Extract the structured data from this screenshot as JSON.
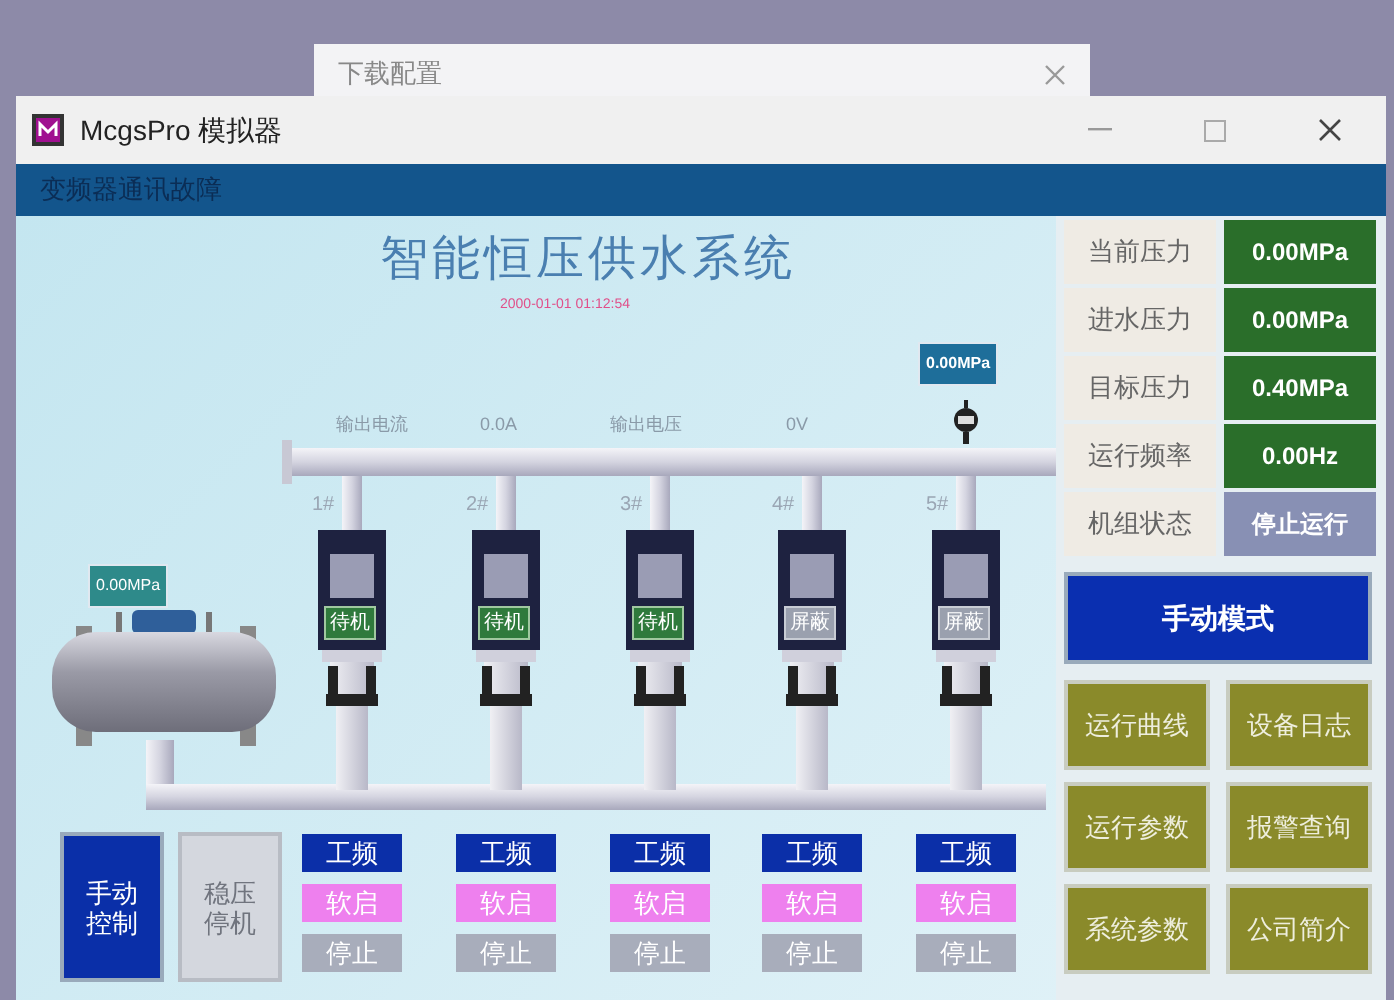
{
  "background_window": {
    "title": "下载配置"
  },
  "window": {
    "title": "McgsPro 模拟器"
  },
  "status_bar": {
    "text": "变频器通讯故障"
  },
  "main": {
    "title": "智能恒压供水系统",
    "timestamp": "2000-01-01 01:12:54",
    "readings": [
      {
        "label": "输出电流",
        "value": "0.0A"
      },
      {
        "label": "输出电压",
        "value": "0V"
      }
    ],
    "outlet_pressure": "0.00MPa",
    "tank_pressure": "0.00MPa",
    "pumps": [
      {
        "number": "1#",
        "status": "待机",
        "kind": "standby",
        "buttons": [
          {
            "label": "工频",
            "kind": "mains"
          },
          {
            "label": "软启",
            "kind": "soft_start"
          },
          {
            "label": "停止",
            "kind": "stop"
          }
        ]
      },
      {
        "number": "2#",
        "status": "待机",
        "kind": "standby",
        "buttons": [
          {
            "label": "工频",
            "kind": "mains"
          },
          {
            "label": "软启",
            "kind": "soft_start"
          },
          {
            "label": "停止",
            "kind": "stop"
          }
        ]
      },
      {
        "number": "3#",
        "status": "待机",
        "kind": "standby",
        "buttons": [
          {
            "label": "工频",
            "kind": "mains"
          },
          {
            "label": "软启",
            "kind": "soft_start"
          },
          {
            "label": "停止",
            "kind": "stop"
          }
        ]
      },
      {
        "number": "4#",
        "status": "屏蔽",
        "kind": "blocked",
        "buttons": [
          {
            "label": "工频",
            "kind": "mains"
          },
          {
            "label": "软启",
            "kind": "soft_start"
          },
          {
            "label": "停止",
            "kind": "stop"
          }
        ]
      },
      {
        "number": "5#",
        "status": "屏蔽",
        "kind": "blocked",
        "buttons": [
          {
            "label": "工频",
            "kind": "mains"
          },
          {
            "label": "软启",
            "kind": "soft_start"
          },
          {
            "label": "停止",
            "kind": "stop"
          }
        ]
      }
    ],
    "control_buttons": [
      {
        "label": "手动控制",
        "disabled": false
      },
      {
        "label": "稳压停机",
        "disabled": true
      }
    ]
  },
  "side_panel": {
    "rows": [
      {
        "label": "当前压力",
        "value": "0.00MPa",
        "kind": "value"
      },
      {
        "label": "进水压力",
        "value": "0.00MPa",
        "kind": "value"
      },
      {
        "label": "目标压力",
        "value": "0.40MPa",
        "kind": "value"
      },
      {
        "label": "运行频率",
        "value": "0.00Hz",
        "kind": "value"
      },
      {
        "label": "机组状态",
        "value": "停止运行",
        "kind": "status"
      }
    ],
    "mode_button": "手动模式",
    "nav_buttons": [
      "运行曲线",
      "设备日志",
      "运行参数",
      "报警查询",
      "系统参数",
      "公司简介"
    ]
  }
}
